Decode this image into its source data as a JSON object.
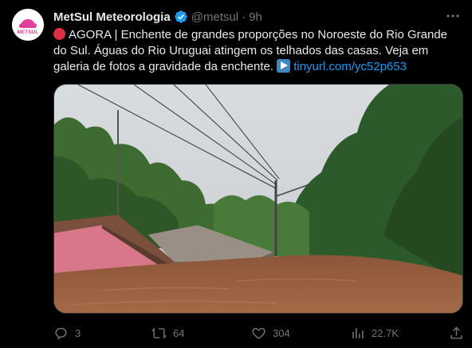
{
  "author": {
    "name": "MetSul Meteorologia",
    "handle": "@metsul",
    "separator": "·",
    "time": "9h",
    "avatar_text": "METSUL",
    "verified_color": "#1d9bf0"
  },
  "tweet": {
    "text_lines": [
      "AGORA | Enchente de grandes proporções no Noroeste do Rio Grande",
      "do Sul. Águas do Rio Uruguai atingem os telhados das casas. Veja em",
      "galeria de fotos a gravidade da enchente."
    ],
    "link": "tinyurl.com/yc52p653"
  },
  "actions": {
    "replies": "3",
    "retweets": "64",
    "likes": "304",
    "views": "22.7K"
  },
  "colors": {
    "background": "#000000",
    "text": "#e7e9ea",
    "muted": "#71767b",
    "link": "#1d9bf0",
    "alert_red": "#dd2e44"
  }
}
